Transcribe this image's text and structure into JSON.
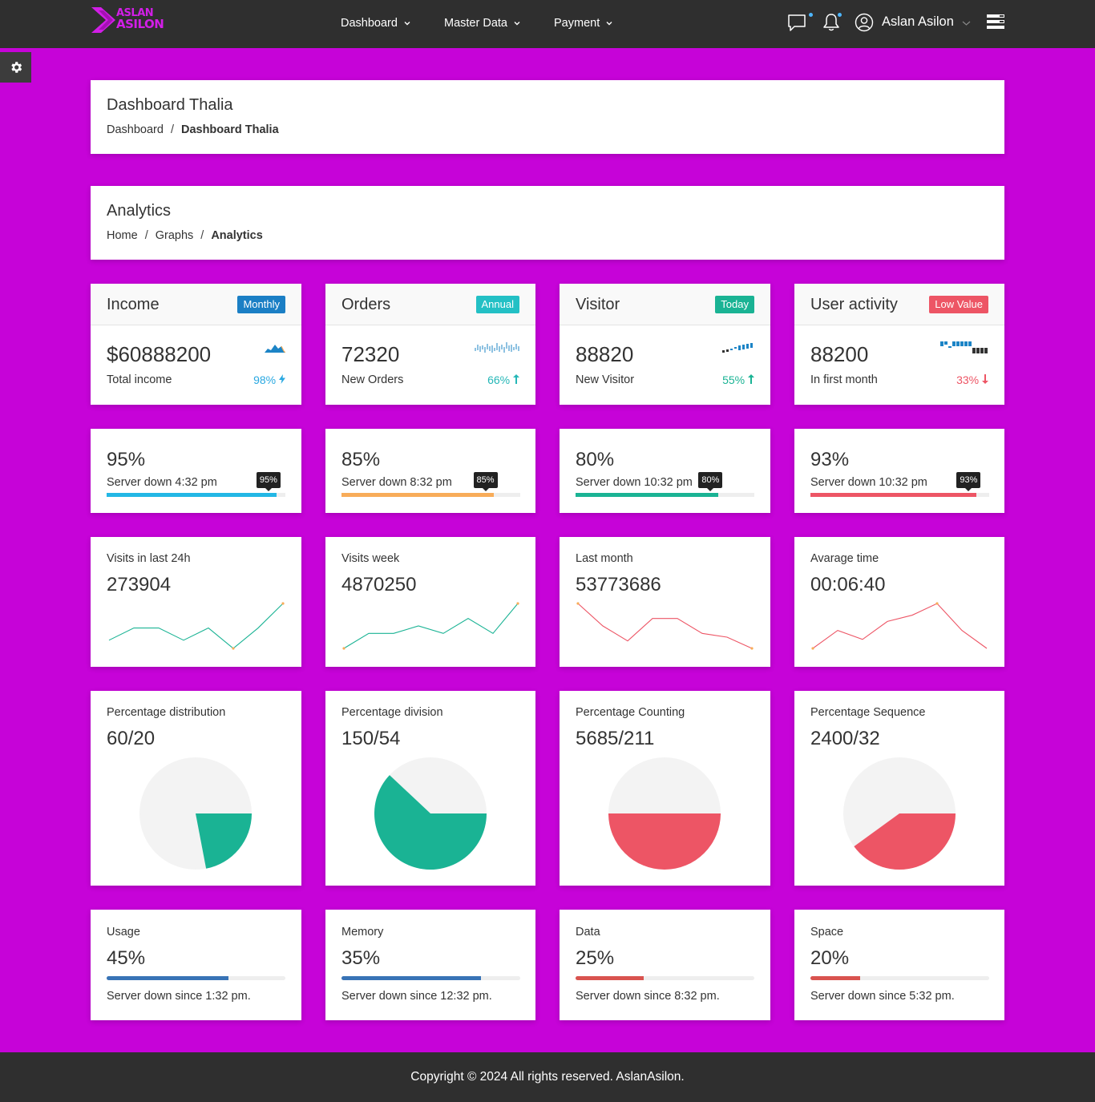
{
  "brand": {
    "line1": "ASLAN",
    "line2": "ASILON",
    "color": "#d21ee7"
  },
  "nav": {
    "items": [
      {
        "label": "Dashboard"
      },
      {
        "label": "Master Data"
      },
      {
        "label": "Payment"
      }
    ],
    "user_name": "Aslan Asilon",
    "icons": [
      "chat-icon",
      "bell-icon",
      "user-icon",
      "menu-icon"
    ]
  },
  "page_header": {
    "title": "Dashboard Thalia",
    "breadcrumb": [
      "Dashboard",
      "Dashboard Thalia"
    ]
  },
  "analytics_header": {
    "title": "Analytics",
    "breadcrumb": [
      "Home",
      "Graphs",
      "Analytics"
    ]
  },
  "stats": [
    {
      "title": "Income",
      "badge": "Monthly",
      "badge_color": "#1b7fc5",
      "value": "$60888200",
      "sub": "Total income",
      "pct": "98%",
      "pct_color": "#29a8e1",
      "pct_icon": "bolt-icon"
    },
    {
      "title": "Orders",
      "badge": "Annual",
      "badge_color": "#23c0c5",
      "value": "72320",
      "sub": "New Orders",
      "pct": "66%",
      "pct_color": "#25b7b7",
      "pct_icon": "arrow-up-icon"
    },
    {
      "title": "Visitor",
      "badge": "Today",
      "badge_color": "#1ab394",
      "value": "88820",
      "sub": "New Visitor",
      "pct": "55%",
      "pct_color": "#1ab394",
      "pct_icon": "arrow-up-icon"
    },
    {
      "title": "User activity",
      "badge": "Low Value",
      "badge_color": "#ed5565",
      "value": "88200",
      "sub": "In first month",
      "pct": "33%",
      "pct_color": "#ed5565",
      "pct_icon": "arrow-down-icon"
    }
  ],
  "progress": [
    {
      "value": "95%",
      "sub": "Server down 4:32 pm",
      "fill": 0.95,
      "tip": "95%",
      "color": "#23b7e5"
    },
    {
      "value": "85%",
      "sub": "Server down 8:32 pm",
      "fill": 0.85,
      "tip": "85%",
      "color": "#f8ac59"
    },
    {
      "value": "80%",
      "sub": "Server down 10:32 pm",
      "fill": 0.8,
      "tip": "80%",
      "color": "#1ab394"
    },
    {
      "value": "93%",
      "sub": "Server down 10:32 pm",
      "fill": 0.93,
      "tip": "93%",
      "color": "#ed5565"
    }
  ],
  "line_cards": [
    {
      "label": "Visits in last 24h",
      "value": "273904",
      "color": "#1ab394"
    },
    {
      "label": "Visits week",
      "value": "4870250",
      "color": "#1ab394"
    },
    {
      "label": "Last month",
      "value": "53773686",
      "color": "#ed5565"
    },
    {
      "label": "Avarage time",
      "value": "00:06:40",
      "color": "#ed5565"
    }
  ],
  "pie_cards": [
    {
      "label": "Percentage distribution",
      "value": "60/20",
      "color": "#1ab394"
    },
    {
      "label": "Percentage division",
      "value": "150/54",
      "color": "#1ab394"
    },
    {
      "label": "Percentage Counting",
      "value": "5685/211",
      "color": "#ed5565"
    },
    {
      "label": "Percentage Sequence",
      "value": "2400/32",
      "color": "#ed5565"
    }
  ],
  "usage": [
    {
      "label": "Usage",
      "value": "45%",
      "fill": 0.68,
      "sub": "Server down since 1:32 pm.",
      "color": "#3873b6"
    },
    {
      "label": "Memory",
      "value": "35%",
      "fill": 0.78,
      "sub": "Server down since 12:32 pm.",
      "color": "#3873b6"
    },
    {
      "label": "Data",
      "value": "25%",
      "fill": 0.38,
      "sub": "Server down since 8:32 pm.",
      "color": "#d9534f"
    },
    {
      "label": "Space",
      "value": "20%",
      "fill": 0.28,
      "sub": "Server down since 5:32 pm.",
      "color": "#d9534f"
    }
  ],
  "chart_data": [
    {
      "type": "line",
      "values": [
        3,
        6,
        6,
        3,
        6,
        1,
        6,
        12
      ]
    },
    {
      "type": "line",
      "values": [
        0,
        2,
        2,
        3,
        2,
        4,
        2,
        6
      ]
    },
    {
      "type": "line",
      "values": [
        6,
        3,
        1,
        4,
        4,
        2,
        1.5,
        0
      ]
    },
    {
      "type": "line",
      "values": [
        0,
        2,
        1,
        3,
        3.7,
        5,
        2,
        0
      ]
    },
    {
      "type": "pie",
      "slices": [
        0.22,
        0.78
      ]
    },
    {
      "type": "pie",
      "slices": [
        0.62,
        0.38
      ]
    },
    {
      "type": "pie",
      "slices": [
        0.5,
        0.5
      ]
    },
    {
      "type": "pie",
      "slices": [
        0.4,
        0.6
      ]
    }
  ],
  "footer": {
    "text": "Copyright © 2024 All rights reserved. AslanAsilon."
  }
}
